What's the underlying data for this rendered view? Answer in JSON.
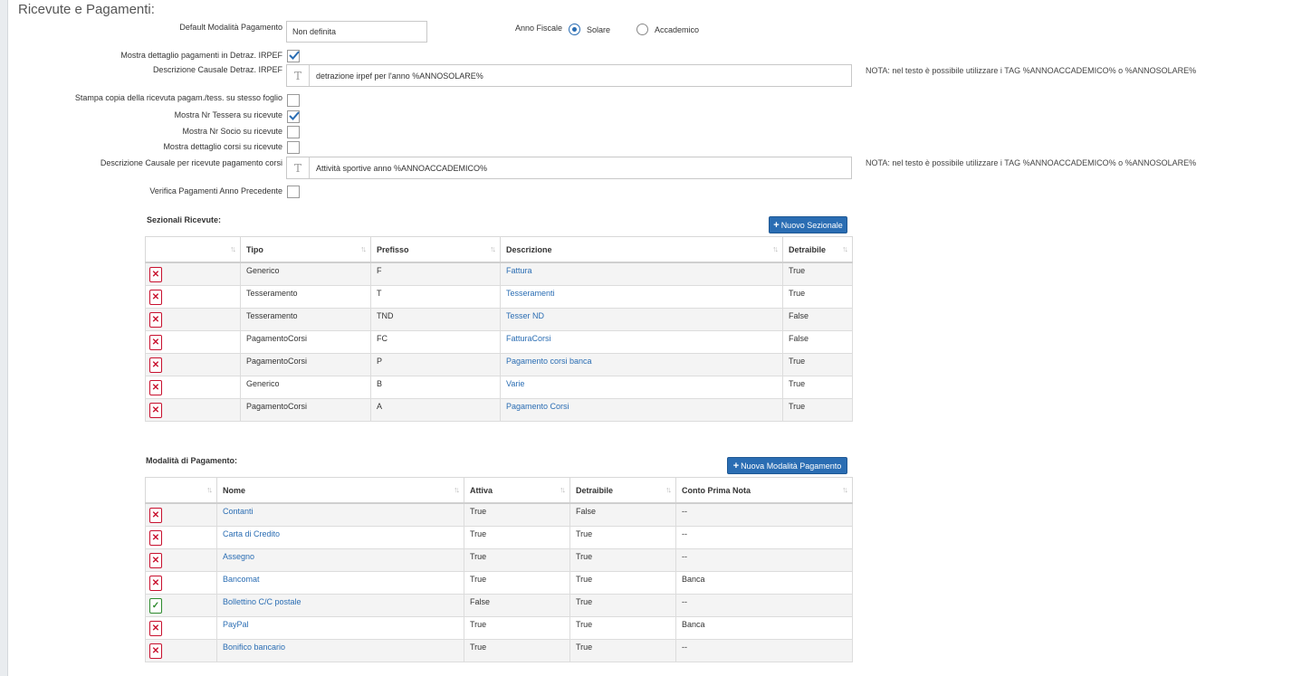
{
  "page": {
    "title": "Ricevute e Pagamenti:"
  },
  "form": {
    "default_modalita_label": "Default Modalità Pagamento",
    "default_modalita_value": "Non definita",
    "anno_fiscale_label": "Anno Fiscale",
    "anno_options": [
      {
        "label": "Solare",
        "selected": true
      },
      {
        "label": "Accademico",
        "selected": false
      }
    ],
    "mostra_dettaglio_irpef_label": "Mostra dettaglio pagamenti in Detraz. IRPEF",
    "mostra_dettaglio_irpef_checked": true,
    "desc_causale_irpef_label": "Descrizione Causale Detraz. IRPEF",
    "desc_causale_irpef_value": "detrazione irpef per l'anno %ANNOSOLARE%",
    "note_irpef": "NOTA: nel testo è possibile utilizzare i TAG %ANNOACCADEMICO% o %ANNOSOLARE%",
    "stampa_copia_label": "Stampa copia della ricevuta pagam./tess. su stesso foglio",
    "stampa_copia_checked": false,
    "mostra_nr_tessera_label": "Mostra Nr Tessera su ricevute",
    "mostra_nr_tessera_checked": true,
    "mostra_nr_socio_label": "Mostra Nr Socio su ricevute",
    "mostra_nr_socio_checked": false,
    "mostra_dettaglio_corsi_label": "Mostra dettaglio corsi su ricevute",
    "mostra_dettaglio_corsi_checked": false,
    "desc_causale_corsi_label": "Descrizione Causale per ricevute pagamento corsi",
    "desc_causale_corsi_value": "Attività sportive anno %ANNOACCADEMICO%",
    "note_corsi": "NOTA: nel testo è possibile utilizzare i TAG %ANNOACCADEMICO% o %ANNOSOLARE%",
    "verifica_pagamenti_label": "Verifica Pagamenti Anno Precedente",
    "verifica_pagamenti_checked": false
  },
  "sezionali": {
    "title": "Sezionali Ricevute:",
    "add_button": "Nuovo Sezionale",
    "columns": [
      "",
      "Tipo",
      "Prefisso",
      "Descrizione",
      "Detraibile"
    ],
    "rows": [
      {
        "tipo": "Generico",
        "prefisso": "F",
        "descrizione": "Fattura",
        "detraibile": "True"
      },
      {
        "tipo": "Tesseramento",
        "prefisso": "T",
        "descrizione": "Tesseramenti",
        "detraibile": "True"
      },
      {
        "tipo": "Tesseramento",
        "prefisso": "TND",
        "descrizione": "Tesser ND",
        "detraibile": "False"
      },
      {
        "tipo": "PagamentoCorsi",
        "prefisso": "FC",
        "descrizione": "FatturaCorsi",
        "detraibile": "False"
      },
      {
        "tipo": "PagamentoCorsi",
        "prefisso": "P",
        "descrizione": "Pagamento corsi banca",
        "detraibile": "True"
      },
      {
        "tipo": "Generico",
        "prefisso": "B",
        "descrizione": "Varie",
        "detraibile": "True"
      },
      {
        "tipo": "PagamentoCorsi",
        "prefisso": "A",
        "descrizione": "Pagamento Corsi",
        "detraibile": "True"
      }
    ]
  },
  "modalita": {
    "title": "Modalità di Pagamento:",
    "add_button": "Nuova Modalità Pagamento",
    "columns": [
      "",
      "Nome",
      "Attiva",
      "Detraibile",
      "Conto Prima Nota"
    ],
    "rows": [
      {
        "action": "delete",
        "nome": "Contanti",
        "attiva": "True",
        "detraibile": "False",
        "conto": "--"
      },
      {
        "action": "delete",
        "nome": "Carta di Credito",
        "attiva": "True",
        "detraibile": "True",
        "conto": "--"
      },
      {
        "action": "delete",
        "nome": "Assegno",
        "attiva": "True",
        "detraibile": "True",
        "conto": "--"
      },
      {
        "action": "delete",
        "nome": "Bancomat",
        "attiva": "True",
        "detraibile": "True",
        "conto": "Banca"
      },
      {
        "action": "activate",
        "nome": "Bollettino C/C postale",
        "attiva": "False",
        "detraibile": "True",
        "conto": "--"
      },
      {
        "action": "delete",
        "nome": "PayPal",
        "attiva": "True",
        "detraibile": "True",
        "conto": "Banca"
      },
      {
        "action": "delete",
        "nome": "Bonifico bancario",
        "attiva": "True",
        "detraibile": "True",
        "conto": "--"
      }
    ]
  },
  "colors": {
    "accent": "#2a6db3",
    "delete": "#c8102e",
    "ok": "#2e8b2e"
  }
}
